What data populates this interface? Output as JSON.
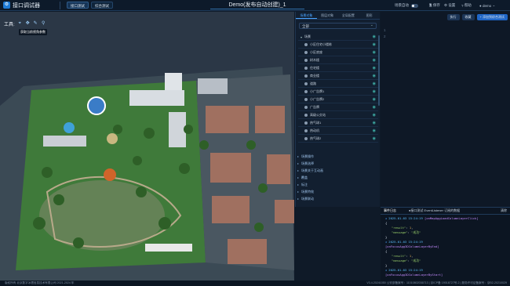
{
  "header": {
    "app_title": "接口调试器",
    "btn_interface_test": "接口测试",
    "btn_combined_test": "综合测试",
    "doc_title": "Demo(发布自动创建)_1",
    "scene_sync": "场景自动",
    "save": "保存",
    "settings": "设置",
    "help": "帮助",
    "user": "demo"
  },
  "toolbar": {
    "label": "工具:",
    "tooltip": "获取当前视角参数"
  },
  "panel": {
    "tabs": [
      "场景对象",
      "图层对象",
      "全局配置",
      "图形"
    ],
    "select_value": "全部",
    "tree": [
      {
        "label": "场景",
        "root": true
      },
      {
        "label": "小区住宅小楼栋"
      },
      {
        "label": "小区底座"
      },
      {
        "label": "树木楼"
      },
      {
        "label": "住宅楼"
      },
      {
        "label": "商业楼"
      },
      {
        "label": "道路"
      },
      {
        "label": "小广告牌1"
      },
      {
        "label": "小广告牌2"
      },
      {
        "label": "广告牌"
      },
      {
        "label": "高级公交站"
      },
      {
        "label": "热气球1"
      },
      {
        "label": "热动机"
      },
      {
        "label": "热气球2"
      }
    ],
    "groups": [
      "场景操作",
      "场景选择",
      "场景关于互动画",
      "覆盖",
      "标注",
      "场景特效",
      "场景联动"
    ]
  },
  "editor": {
    "run": "执行",
    "collect": "收藏",
    "add_to_combined": "+ 添加到综合测试",
    "line_numbers": [
      "1",
      "2"
    ]
  },
  "log": {
    "tabs": [
      "事件日志",
      "●接口测试 EventListener 订阅的数据",
      "清除"
    ],
    "entries": [
      {
        "time": "2025-01-03 15:24:19",
        "api": "[onMapAggLoadColumnLayerClick]",
        "result": "1",
        "message": "\"成功\""
      },
      {
        "time": "2025-01-03 15:24:19",
        "api": "[onFocusAgg3DColumnLayerByEnd]",
        "result": "1",
        "message": "\"成功\""
      },
      {
        "time": "2025-01-03 15:24:19",
        "api": "[onFocusAgg3DColumnLayerByStart]"
      }
    ]
  },
  "status": {
    "left": "版权所有 北京数字冰雹信息技术有限公司 2021-2024 年",
    "right": "V3.4.20241050 公安部备案号：11010802036713 | 京ICP备 19018727号-2 | 服务许可证备案号：京B2-20210029"
  }
}
